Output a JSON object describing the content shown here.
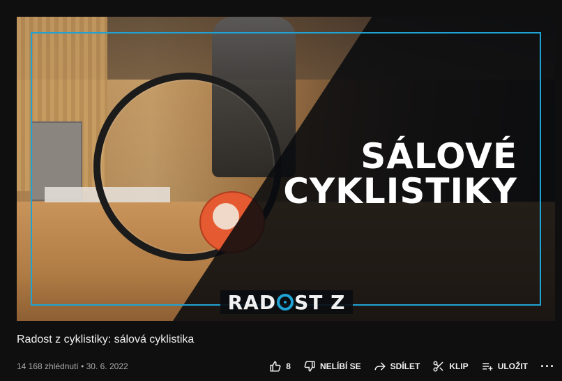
{
  "thumbnail": {
    "headline_line1": "SÁLOVÉ",
    "headline_line2": "CYKLISTIKY",
    "logo_left": "RAD",
    "logo_right": "ST Z"
  },
  "video": {
    "title": "Radost z cyklistiky: sálová cyklistika",
    "meta": "14 168 zhlédnutí • 30. 6. 2022"
  },
  "actions": {
    "like_count": "8",
    "dislike_label": "NELÍBÍ SE",
    "share_label": "SDÍLET",
    "clip_label": "KLIP",
    "save_label": "ULOŽIT",
    "more_label": "···"
  },
  "colors": {
    "accent": "#1fa3d4",
    "background": "#0f0f0f",
    "text": "#f1f1f1",
    "meta": "#aaaaaa"
  },
  "icons": {
    "like": "thumbs-up-icon",
    "dislike": "thumbs-down-icon",
    "share": "share-icon",
    "clip": "scissors-icon",
    "save": "playlist-add-icon",
    "more": "more-icon"
  }
}
